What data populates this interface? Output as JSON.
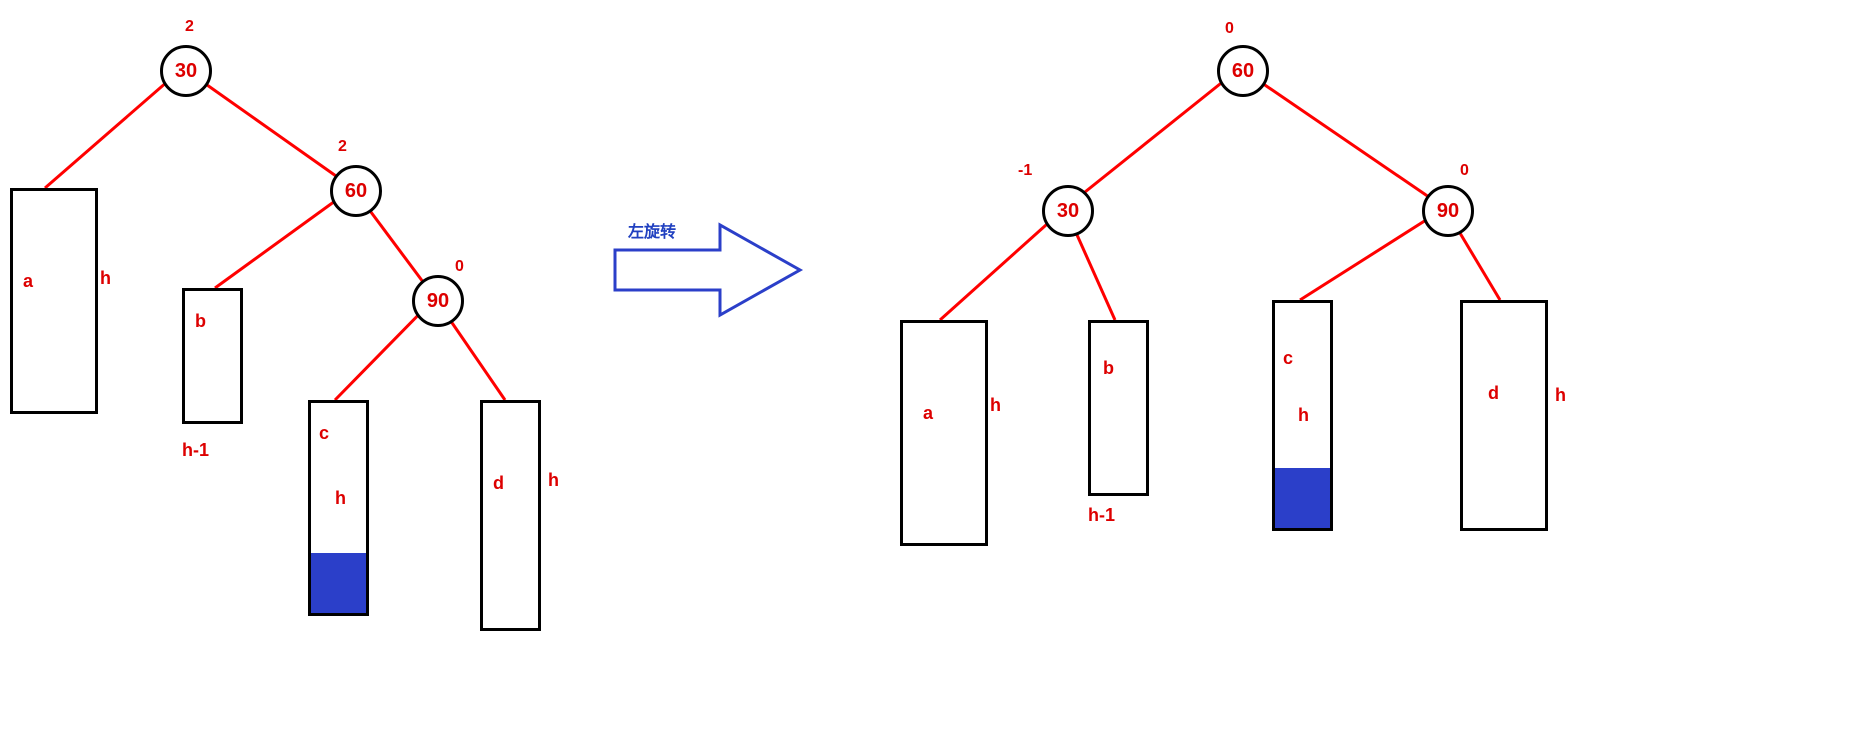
{
  "diagram": {
    "operation_label": "左旋转",
    "colors": {
      "edge": "#ff0000",
      "node_border": "#000000",
      "node_text": "#d00000",
      "arrow": "#2b3fc9",
      "fill": "#2b3fc9"
    },
    "left_tree": {
      "nodes": {
        "n30": {
          "value": "30",
          "balance": "2"
        },
        "n60": {
          "value": "60",
          "balance": "2"
        },
        "n90": {
          "value": "90",
          "balance": "0"
        }
      },
      "subtrees": {
        "a": {
          "label": "a",
          "height_label": "h"
        },
        "b": {
          "label": "b",
          "height_label": "h-1"
        },
        "c": {
          "label": "c",
          "height_label": "h"
        },
        "d": {
          "label": "d",
          "height_label": "h"
        }
      }
    },
    "right_tree": {
      "nodes": {
        "n60": {
          "value": "60",
          "balance": "0"
        },
        "n30": {
          "value": "30",
          "balance": "-1"
        },
        "n90": {
          "value": "90",
          "balance": "0"
        }
      },
      "subtrees": {
        "a": {
          "label": "a",
          "height_label": "h"
        },
        "b": {
          "label": "b",
          "height_label": "h-1"
        },
        "c": {
          "label": "c",
          "height_label": "h"
        },
        "d": {
          "label": "d",
          "height_label": "h"
        }
      }
    }
  }
}
